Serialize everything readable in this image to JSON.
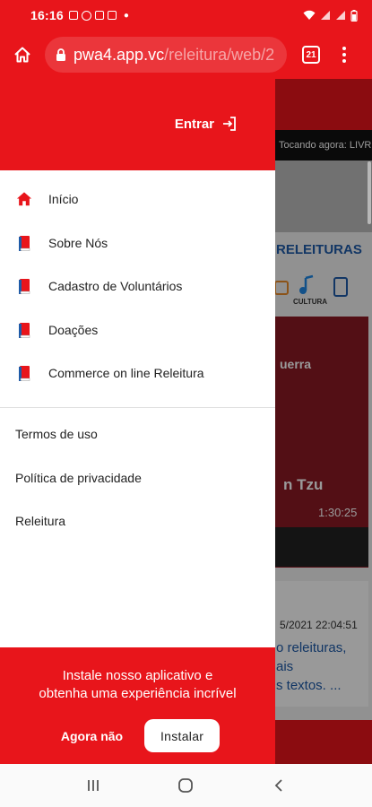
{
  "status_bar": {
    "time": "16:16",
    "icons": [
      "gallery-icon",
      "whatsapp-icon",
      "camera-icon",
      "gmail-icon",
      "dot-icon",
      "wifi-icon",
      "signal-icon",
      "battery-icon"
    ]
  },
  "browser": {
    "url_host": "pwa4.app.vc",
    "url_path": "/releitura/web/2",
    "tab_count": "21"
  },
  "drawer": {
    "login_label": "Entrar",
    "menu_items": [
      {
        "label": "Início",
        "icon": "home-icon"
      },
      {
        "label": "Sobre Nós",
        "icon": "book-icon"
      },
      {
        "label": "Cadastro de Voluntários",
        "icon": "book-icon"
      },
      {
        "label": "Doações",
        "icon": "book-icon"
      },
      {
        "label": "Commerce on line Releitura",
        "icon": "book-icon"
      }
    ],
    "links": [
      {
        "label": "Termos de uso"
      },
      {
        "label": "Política de privacidade"
      },
      {
        "label": "Releitura"
      }
    ]
  },
  "install_banner": {
    "line1": "Instale nosso aplicativo e",
    "line2": "obtenha uma experiência incrível",
    "dismiss_label": "Agora não",
    "install_label": "Instalar"
  },
  "background_page": {
    "now_playing": "Tocando agora: LIVR",
    "logo_text": "RELEITURAS",
    "icon_label": "CULTURA",
    "video_title_fragment": "uerra",
    "video_subtitle_fragment": "n Tzu",
    "video_duration": "1:30:25",
    "post_date": "5/2021 22:04:51",
    "post_text_line1": "o releituras,",
    "post_text_line2": "ais",
    "post_text_line3": "s textos. ..."
  },
  "colors": {
    "brand_red": "#e8151b",
    "menu_icon_red": "#e8151b",
    "menu_icon_blue": "#1e5ba8"
  }
}
